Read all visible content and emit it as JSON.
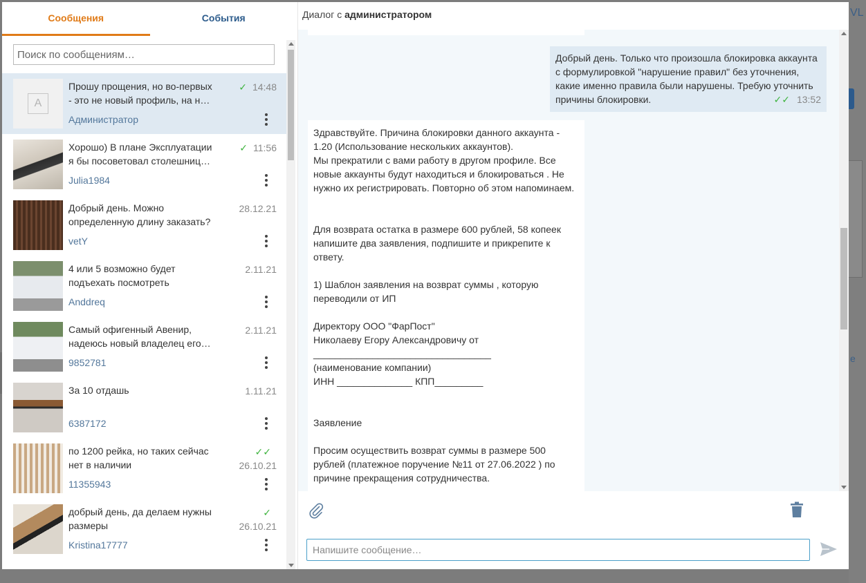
{
  "backdrop": {
    "corner_text": "VL",
    "edge_text": "e"
  },
  "tabs": [
    {
      "label": "Сообщения",
      "active": true
    },
    {
      "label": "События",
      "active": false
    }
  ],
  "search": {
    "placeholder": "Поиск по сообщениям…"
  },
  "conversations": [
    {
      "preview": "Прошу прощения, но во-первых - это не новый профиль, на н…",
      "author": "Администратор",
      "time": "14:48",
      "status": "single-check",
      "avatar": "A",
      "selected": true
    },
    {
      "preview": "Хорошо) В плане Эксплуатации я бы посоветовал столешниц…",
      "author": "Julia1984",
      "time": "11:56",
      "status": "single-check"
    },
    {
      "preview": "Добрый день. Можно определенную длину заказать?",
      "author": "vetY",
      "time": "28.12.21",
      "status": "none"
    },
    {
      "preview": "4 или 5 возможно будет подъехать посмотреть",
      "author": "Anddreq",
      "time": "2.11.21",
      "status": "none"
    },
    {
      "preview": "Самый офигенный Авенир, надеюсь новый владелец его…",
      "author": "9852781",
      "time": "2.11.21",
      "status": "none"
    },
    {
      "preview": "За 10 отдашь",
      "author": "6387172",
      "time": "1.11.21",
      "status": "none"
    },
    {
      "preview": "по 1200 рейка, но таких сейчас нет в наличии",
      "author": "11355943",
      "time": "26.10.21",
      "status": "double-check"
    },
    {
      "preview": "добрый день, да делаем нужны размеры",
      "author": "Kristina17777",
      "time": "26.10.21",
      "status": "single-check"
    }
  ],
  "dialog": {
    "title_prefix": "Диалог с",
    "title_name": "администратором"
  },
  "messages": {
    "outgoing": {
      "text": "Добрый день. Только что произошла блокировка аккаунта с формулировкой \"нарушение правил\" без уточнения, какие именно правила были нарушены. Требую уточнить причины блокировки.",
      "time": "13:52"
    },
    "incoming": {
      "text": "Здравствуйте. Причина блокировки данного аккаунта - 1.20 (Использование нескольких аккаунтов).\nМы прекратили с вами работу в другом профиле. Все новые аккаунты будут находиться и блокироваться . Не нужно их регистрировать. Повторно об этом напоминаем.\n\n\nДля возврата остатка в размере 600 рублей, 58 копеек напишите два заявления, подпишите и прикрепите к ответу.\n\n1) Шаблон заявления на возврат суммы , которую переводили от ИП\n\nДиректору ООО \"ФарПост\"\nНиколаеву Егору Александровичу от\n_________________________________\n(наименование компании)\nИНН ______________ КПП_________\n\n\nЗаявление\n\nПросим осуществить возврат суммы в размере 500 рублей (платежное поручение №11 от 27.06.2022 ) по причине прекращения сотрудничества."
    }
  },
  "composer": {
    "placeholder": "Напишите сообщение…"
  },
  "icons": {
    "attach": "paperclip-icon",
    "delete": "trash-icon",
    "send": "send-icon",
    "menu": "kebab-icon",
    "check": "✓",
    "double_check": "✓✓"
  },
  "colors": {
    "accent": "#e07b18",
    "link": "#2d5c8c",
    "check": "#3db33d",
    "selected": "#dfe9f2",
    "outgoing_bubble": "#dfeaf3"
  }
}
